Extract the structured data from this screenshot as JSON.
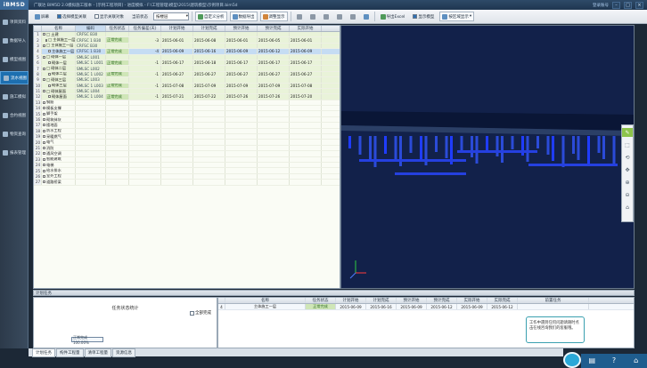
{
  "app": {
    "logo": "iBMSD",
    "title": "广联达 BIM5D 2.0模拟施工版本 - [示例工程项目] - 进度模拟 - F:\\工程管理\\模型\\2015\\建筑模型\\示例项目.bim5d",
    "login": "登录账号",
    "window_controls": [
      "–",
      "□",
      "×"
    ]
  },
  "sidebar": {
    "items": [
      {
        "label": "项目资料",
        "icon": "folder-icon"
      },
      {
        "label": "数据导入",
        "icon": "import-icon"
      },
      {
        "label": "模型视图",
        "icon": "cube-icon"
      },
      {
        "label": "流水视图",
        "icon": "flow-icon",
        "active": true
      },
      {
        "label": "施工模拟",
        "icon": "play-icon"
      },
      {
        "label": "合约视图",
        "icon": "contract-icon"
      },
      {
        "label": "物资查询",
        "icon": "search-icon"
      },
      {
        "label": "报表管理",
        "icon": "report-icon"
      }
    ]
  },
  "toolbar": {
    "items": [
      {
        "label": "屏幕",
        "icon": "home-icon"
      },
      {
        "label": "选择模型关联",
        "check": true
      },
      {
        "label": "显示关联对象",
        "check": false
      },
      {
        "label": "自定义分析"
      },
      {
        "label": "数据导出"
      },
      {
        "label": "调整显示"
      },
      {
        "label": "导出Excel"
      },
      {
        "label": "显示模型",
        "check": true
      },
      {
        "label": "按区域显示"
      }
    ],
    "select_label": "当前状态",
    "select_value": "按楼层"
  },
  "grid": {
    "columns": [
      "名称",
      "编码",
      "任务状态",
      "任务偏差(天)",
      "计划开始",
      "计划完成",
      "预计开始",
      "预计完成",
      "实际开始"
    ],
    "rows": [
      {
        "n": "1",
        "name": "□ 土建",
        "code": "CRFSC B30",
        "status": "",
        "dev": "",
        "ps": "",
        "pf": "",
        "es": "",
        "ef": "",
        "as": "",
        "level": 0,
        "filled": true
      },
      {
        "n": "2",
        "name": "□ 主体施工一层",
        "code": "CRFSC 1 B30",
        "status": "正常完成",
        "dev": "-3",
        "ps": "2015-06-01",
        "pf": "2015-06-08",
        "es": "2015-06-01",
        "ef": "2015-06-05",
        "as": "2015-06-01",
        "level": 1,
        "filled": true
      },
      {
        "n": "3",
        "name": "□ 主体施工一层",
        "code": "CRFSC B30",
        "status": "",
        "dev": "",
        "ps": "",
        "pf": "",
        "es": "",
        "ef": "",
        "as": "",
        "level": 0,
        "filled": true
      },
      {
        "n": "4",
        "name": "主体施工一层",
        "code": "CRFSC 1 B30",
        "status": "正常完成",
        "dev": "-4",
        "ps": "2015-06-09",
        "pf": "2015-06-16",
        "es": "2015-06-09",
        "ef": "2015-06-12",
        "as": "2015-06-09",
        "level": 2,
        "filled": true,
        "selected": true
      },
      {
        "n": "5",
        "name": "□ 砌体一层",
        "code": "SMLSC L001",
        "status": "",
        "dev": "",
        "ps": "",
        "pf": "",
        "es": "",
        "ef": "",
        "as": "",
        "level": 0,
        "filled": true
      },
      {
        "n": "6",
        "name": "砌体一层",
        "code": "SMLSC 1 L001",
        "status": "正常完成",
        "dev": "-1",
        "ps": "2015-06-17",
        "pf": "2015-06-18",
        "es": "2015-06-17",
        "ef": "2015-06-17",
        "as": "2015-06-17",
        "level": 2,
        "filled": true
      },
      {
        "n": "7",
        "name": "□ 砌体二层",
        "code": "SMLSC L002",
        "status": "",
        "dev": "",
        "ps": "",
        "pf": "",
        "es": "",
        "ef": "",
        "as": "",
        "level": 0,
        "filled": true
      },
      {
        "n": "8",
        "name": "砌体二层",
        "code": "SMLSC 1 L002",
        "status": "正常完成",
        "dev": "-1",
        "ps": "2015-06-27",
        "pf": "2015-06-27",
        "es": "2015-06-27",
        "ef": "2015-06-27",
        "as": "2015-06-27",
        "level": 2,
        "filled": true
      },
      {
        "n": "9",
        "name": "□ 砌体三层",
        "code": "SMLSC L003",
        "status": "",
        "dev": "",
        "ps": "",
        "pf": "",
        "es": "",
        "ef": "",
        "as": "",
        "level": 0,
        "filled": true
      },
      {
        "n": "10",
        "name": "砌体三层",
        "code": "SMLSC 1 L003",
        "status": "正常完成",
        "dev": "-1",
        "ps": "2015-07-08",
        "pf": "2015-07-09",
        "es": "2015-07-09",
        "ef": "2015-07-09",
        "as": "2015-07-08",
        "level": 2,
        "filled": true
      },
      {
        "n": "11",
        "name": "□ 砌体屋面",
        "code": "SMLSC L004",
        "status": "",
        "dev": "",
        "ps": "",
        "pf": "",
        "es": "",
        "ef": "",
        "as": "",
        "level": 0,
        "filled": true
      },
      {
        "n": "12",
        "name": "砌体屋面",
        "code": "SMLSC 1 L004",
        "status": "正常完成",
        "dev": "-1",
        "ps": "2015-07-21",
        "pf": "2015-07-22",
        "es": "2015-07-26",
        "ef": "2015-07-26",
        "as": "2015-07-20",
        "level": 2,
        "filled": true
      },
      {
        "n": "13",
        "name": "钢筋",
        "level": 0
      },
      {
        "n": "14",
        "name": "模板支撑",
        "level": 0
      },
      {
        "n": "15",
        "name": "脚手架",
        "level": 0
      },
      {
        "n": "16",
        "name": "砌筑抹灰",
        "level": 0
      },
      {
        "n": "17",
        "name": "楼地面",
        "level": 0
      },
      {
        "n": "18",
        "name": "防水工程",
        "level": 0
      },
      {
        "n": "19",
        "name": "采暖燃气",
        "level": 0
      },
      {
        "n": "20",
        "name": "电气",
        "level": 0
      },
      {
        "n": "21",
        "name": "消防",
        "level": 0
      },
      {
        "n": "22",
        "name": "通风空调",
        "level": 0
      },
      {
        "n": "23",
        "name": "智能建筑",
        "level": 0
      },
      {
        "n": "24",
        "name": "电梯",
        "level": 0
      },
      {
        "n": "25",
        "name": "给水排水",
        "level": 0
      },
      {
        "n": "26",
        "name": "室外工程",
        "level": 0
      },
      {
        "n": "27",
        "name": "道路桥梁",
        "level": 0
      }
    ]
  },
  "viewport": {
    "tools": [
      "✎",
      "⬚",
      "⟲",
      "✥",
      "⊕",
      "⊖",
      "⌂"
    ]
  },
  "bottom": {
    "panel_title": "计划任务",
    "stats_title": "任务状态统计",
    "stats_check_label": "全部完成",
    "stats_bar_label": "正常完成 100.00%",
    "detail_columns": [
      "",
      "名称",
      "任务状态",
      "计划开始",
      "计划完成",
      "预计开始",
      "预计完成",
      "实际开始",
      "实际完成",
      "前置任务"
    ],
    "detail_row": [
      "4",
      "主体施工一层",
      "正常完成",
      "2015-06-09",
      "2015-06-16",
      "2015-06-09",
      "2015-06-12",
      "2015-06-09",
      "2015-06-12",
      ""
    ],
    "tabs": [
      "计划任务",
      "构件工程量",
      "清单工程量",
      "资源信息"
    ],
    "chat_text": "工作中遇到任何问题请随时点击在线咨询我们的客服哦。",
    "dock": [
      "▤",
      "?",
      "⌂"
    ]
  }
}
